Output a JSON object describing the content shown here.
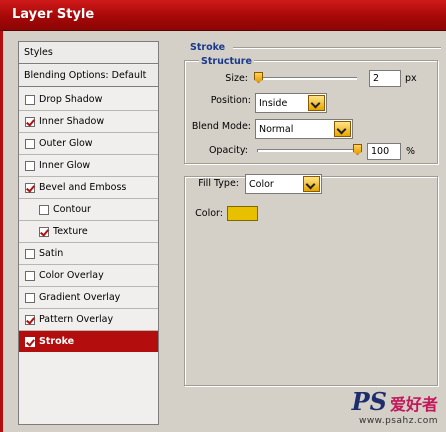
{
  "window": {
    "title": "Layer Style"
  },
  "styles_list": {
    "header": "Styles",
    "blending": "Blending Options: Default",
    "items": [
      {
        "label": "Drop Shadow",
        "checked": false
      },
      {
        "label": "Inner Shadow",
        "checked": true
      },
      {
        "label": "Outer Glow",
        "checked": false
      },
      {
        "label": "Inner Glow",
        "checked": false
      },
      {
        "label": "Bevel and Emboss",
        "checked": true
      },
      {
        "label": "Contour",
        "checked": false
      },
      {
        "label": "Texture",
        "checked": true
      },
      {
        "label": "Satin",
        "checked": false
      },
      {
        "label": "Color Overlay",
        "checked": false
      },
      {
        "label": "Gradient Overlay",
        "checked": false
      },
      {
        "label": "Pattern Overlay",
        "checked": true
      },
      {
        "label": "Stroke",
        "checked": true,
        "selected": true
      }
    ]
  },
  "stroke": {
    "section_title": "Stroke",
    "structure_title": "Structure",
    "size": {
      "label": "Size:",
      "value": "2",
      "unit": "px"
    },
    "position": {
      "label": "Position:",
      "value": "Inside"
    },
    "blend_mode": {
      "label": "Blend Mode:",
      "value": "Normal"
    },
    "opacity": {
      "label": "Opacity:",
      "value": "100",
      "unit": "%"
    },
    "fill_type": {
      "label": "Fill Type:",
      "value": "Color"
    },
    "color": {
      "label": "Color:",
      "swatch": "#e8c000"
    }
  },
  "colors": {
    "title_bar": "#b40d0d",
    "selected_row": "#b40d0d",
    "accent_heading": "#1a3a8c"
  },
  "watermark": {
    "logo": "PS",
    "cjk": "爱好者",
    "url": "www.psahz.com"
  }
}
